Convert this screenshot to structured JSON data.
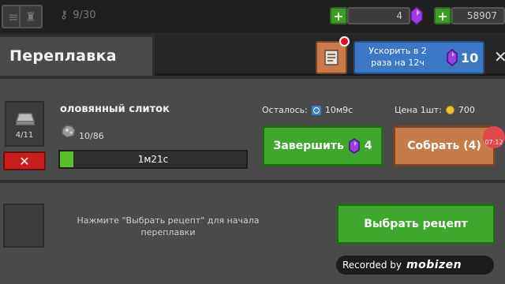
{
  "topbar": {
    "keys": "9/30",
    "gems": "4",
    "coins": "58907"
  },
  "dialog": {
    "title": "Переплавка",
    "speedup": {
      "label": "Ускорить в 2 раза на 12ч",
      "cost": "10"
    }
  },
  "recipe": {
    "slot_count": "4/11",
    "item_name": "оловянный слиток",
    "ore_count": "10/86",
    "timer": "1м21с",
    "progress": 0.07,
    "remaining_label": "Осталось:",
    "remaining_value": "10м9с",
    "price_label": "Цена 1шт:",
    "price_value": "700",
    "finish_label": "Завершить",
    "finish_cost": "4",
    "collect_label": "Собрать (4)"
  },
  "empty_slot": {
    "hint": "Нажмите \"Выбрать рецепт\" для начала переплавки",
    "choose_label": "Выбрать рецепт"
  },
  "overlay": {
    "rec_time": "07:12",
    "watermark_text": "Recorded by",
    "watermark_logo": "mobizen"
  },
  "colors": {
    "green": "#3da82c",
    "orange": "#c77b48",
    "blue": "#3c78c6",
    "red": "#c81e1e",
    "gem": "#9b3fe0"
  }
}
